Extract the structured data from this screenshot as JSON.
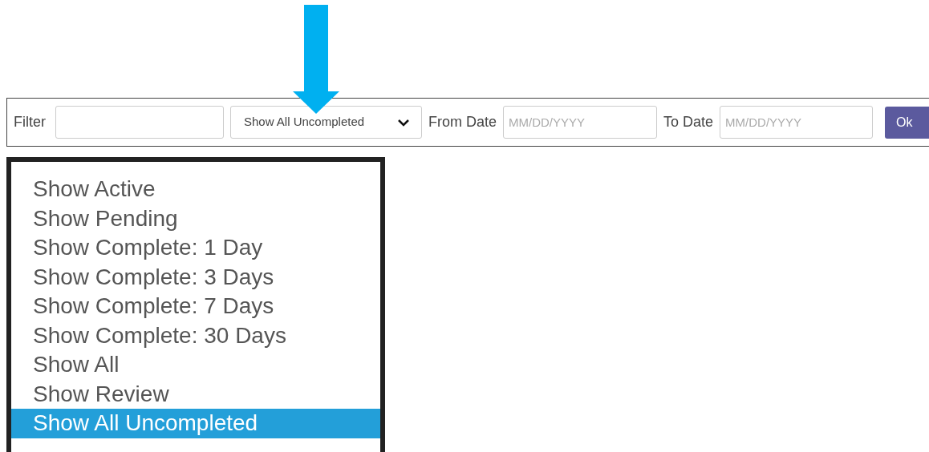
{
  "filter_bar": {
    "filter_label": "Filter",
    "status_select": {
      "value": "Show All Uncompleted"
    },
    "from_date": {
      "label": "From Date",
      "placeholder": "MM/DD/YYYY"
    },
    "to_date": {
      "label": "To Date",
      "placeholder": "MM/DD/YYYY"
    },
    "ok_button": "Ok"
  },
  "dropdown_options": [
    {
      "label": "Show Active",
      "selected": false
    },
    {
      "label": "Show Pending",
      "selected": false
    },
    {
      "label": "Show Complete: 1 Day",
      "selected": false
    },
    {
      "label": "Show Complete: 3 Days",
      "selected": false
    },
    {
      "label": "Show Complete: 7 Days",
      "selected": false
    },
    {
      "label": "Show Complete: 30 Days",
      "selected": false
    },
    {
      "label": "Show All",
      "selected": false
    },
    {
      "label": "Show Review",
      "selected": false
    },
    {
      "label": "Show All Uncompleted",
      "selected": true
    }
  ]
}
